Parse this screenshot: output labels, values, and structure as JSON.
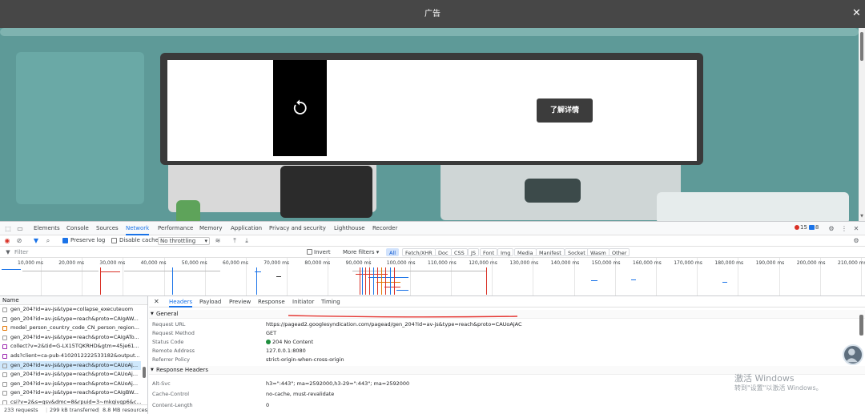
{
  "ad": {
    "title": "广告",
    "close_icon": "close-icon",
    "cta_label": "了解详情",
    "replay_icon": "replay-icon"
  },
  "devtools": {
    "tabs": [
      "Elements",
      "Console",
      "Sources",
      "Network",
      "Performance",
      "Memory",
      "Application",
      "Privacy and security",
      "Lighthouse",
      "Recorder"
    ],
    "active_tab": "Network",
    "errors": "15",
    "messages": "8",
    "toolbar": {
      "preserve_log": "Preserve log",
      "disable_cache": "Disable cache",
      "throttle": "No throttling"
    },
    "filter": {
      "placeholder": "Filter",
      "invert": "Invert",
      "more_filters": "More filters ▾",
      "types": [
        "All",
        "Fetch/XHR",
        "Doc",
        "CSS",
        "JS",
        "Font",
        "Img",
        "Media",
        "Manifest",
        "Socket",
        "Wasm",
        "Other"
      ],
      "active_type": "All"
    },
    "overview_ticks": [
      "10,000 ms",
      "20,000 ms",
      "30,000 ms",
      "40,000 ms",
      "50,000 ms",
      "60,000 ms",
      "70,000 ms",
      "80,000 ms",
      "90,000 ms",
      "100,000 ms",
      "110,000 ms",
      "120,000 ms",
      "130,000 ms",
      "140,000 ms",
      "150,000 ms",
      "160,000 ms",
      "170,000 ms",
      "180,000 ms",
      "190,000 ms",
      "200,000 ms",
      "210,000 ms"
    ],
    "list": {
      "header": "Name",
      "rows": [
        "gen_204?id=av-js&type=collapse_executeuom",
        "gen_204?id=av-js&type=reach&proto=CAIgAW...",
        "model_person_country_code_CN_person_region...",
        "gen_204?id=av-js&type=reach&proto=CAIgATo...",
        "collect?v=2&tid=G-LX15TQKRHD&gtm=45je61...",
        "ads?client=ca-pub-4102012222533182&output...",
        "gen_204?id=av-js&type=reach&proto=CAUoAj...",
        "gen_204?id=av-js&type=reach&proto=CAUoAj...",
        "gen_204?id=av-js&type=reach&proto=CAUoAj...",
        "gen_204?id=av-js&type=reach&proto=CAIgBW...",
        "csi?v=2&s=gsv&dmc=8&rpuid=3~mkqivgp6&c..."
      ],
      "selected_index": 6
    },
    "status": {
      "requests": "233 requests",
      "transferred": "299 kB transferred",
      "resources": "8.8 MB resources"
    },
    "detail": {
      "tabs": [
        "Headers",
        "Payload",
        "Preview",
        "Response",
        "Initiator",
        "Timing"
      ],
      "active_tab": "Headers",
      "general_title": "General",
      "general": [
        {
          "key": "Request URL",
          "value": "https://pagead2.googlesyndication.com/pagead/gen_204?id=av-js&type=reach&proto=CAUoAjAC"
        },
        {
          "key": "Request Method",
          "value": "GET"
        },
        {
          "key": "Status Code",
          "value": "204 No Content"
        },
        {
          "key": "Remote Address",
          "value": "127.0.0.1:8080"
        },
        {
          "key": "Referrer Policy",
          "value": "strict-origin-when-cross-origin"
        }
      ],
      "response_title": "Response Headers",
      "response": [
        {
          "key": "Alt-Svc",
          "value": "h3=\":443\"; ma=2592000,h3-29=\":443\"; ma=2592000"
        },
        {
          "key": "Cache-Control",
          "value": "no-cache, must-revalidate"
        },
        {
          "key": "Content-Length",
          "value": "0"
        }
      ]
    }
  },
  "watermark": {
    "line1": "激活 Windows",
    "line2": "转到\"设置\"以激活 Windows。"
  },
  "colors": {
    "accent": "#1a73e8",
    "error": "#d93025",
    "success": "#1e8e3e",
    "annotation": "#e53935"
  }
}
